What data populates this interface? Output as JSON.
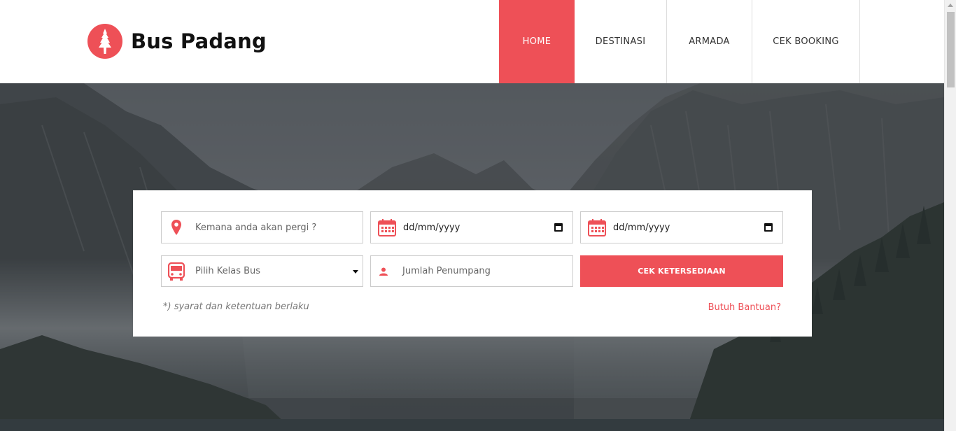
{
  "brand": {
    "name": "Bus Padang",
    "icon": "tree-icon",
    "accent": "#ee5057"
  },
  "nav": {
    "items": [
      {
        "label": "HOME",
        "active": true
      },
      {
        "label": "DESTINASI",
        "active": false
      },
      {
        "label": "ARMADA",
        "active": false
      },
      {
        "label": "CEK BOOKING",
        "active": false
      }
    ]
  },
  "search": {
    "destination": {
      "placeholder": "Kemana anda akan pergi ?",
      "icon": "map-marker-icon"
    },
    "date_depart": {
      "value": "dd/mm/yyyy",
      "icon": "calendar-icon"
    },
    "date_return": {
      "value": "dd/mm/yyyy",
      "icon": "calendar-icon"
    },
    "bus_class": {
      "selected": "Pilih Kelas Bus",
      "icon": "bus-icon"
    },
    "passengers": {
      "placeholder": "Jumlah Penumpang",
      "icon": "user-icon"
    },
    "submit_label": "CEK KETERSEDIAAN",
    "note": "*) syarat dan ketentuan berlaku",
    "help_link": "Butuh Bantuan?"
  }
}
